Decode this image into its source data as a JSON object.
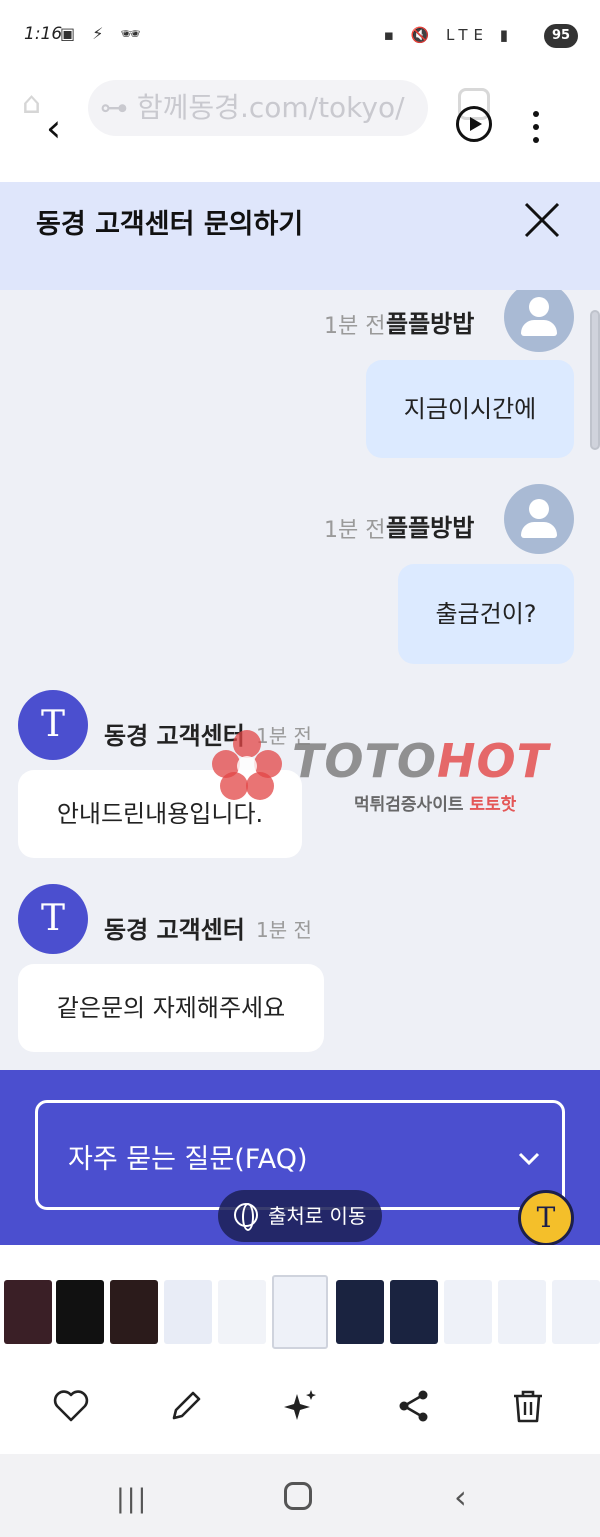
{
  "status_bar": {
    "time": "1:16",
    "left_icons": "▣ ⚡ 🕶",
    "right_icons": "▪ 🔇 LTE ▮",
    "battery": "95"
  },
  "browser": {
    "ghost_url": "⊶ 함께동경.com/tokyo/",
    "back_label": "‹"
  },
  "header": {
    "title": "동경 고객센터 문의하기"
  },
  "messages": {
    "m1": {
      "time": "1분 전",
      "name": "플플방밥",
      "text": "지금이시간에"
    },
    "m2": {
      "time": "1분 전",
      "name": "플플방밥",
      "text": "출금건이?"
    },
    "m3": {
      "avatar": "T",
      "name": "동경 고객센터",
      "time": "1분 전",
      "text": "안내드린내용입니다."
    },
    "m4": {
      "avatar": "T",
      "name": "동경 고객센터",
      "time": "1분 전",
      "text": "같은문의 자제해주세요"
    }
  },
  "watermark": {
    "brand_a": "TOTO",
    "brand_b": "HOT",
    "sub_a": "먹튀검증사이트",
    "sub_b": "토토핫"
  },
  "faq": {
    "label": "자주 묻는 질문(FAQ)"
  },
  "overlay": {
    "source_label": "출처로 이동",
    "lens_label": "T"
  },
  "gallery": {
    "thumb_colors": [
      "#3a1f26",
      "#111111",
      "#2b1b1b",
      "#e8ecf6",
      "#f1f3f8",
      "#eef1f8",
      "#1a2340",
      "#1a2340",
      "#eef1f8",
      "#eef1f8",
      "#eef1f8"
    ]
  },
  "actions": [
    "heart-icon",
    "pencil-icon",
    "sparkle-icon",
    "share-icon",
    "trash-icon"
  ],
  "nav": {
    "recents": "|||",
    "back": "‹"
  },
  "colors": {
    "accent": "#4b4fcf",
    "header_bg": "#dfe6fb",
    "user_bubble": "#dceaff",
    "chat_bg": "#eef0f6"
  }
}
